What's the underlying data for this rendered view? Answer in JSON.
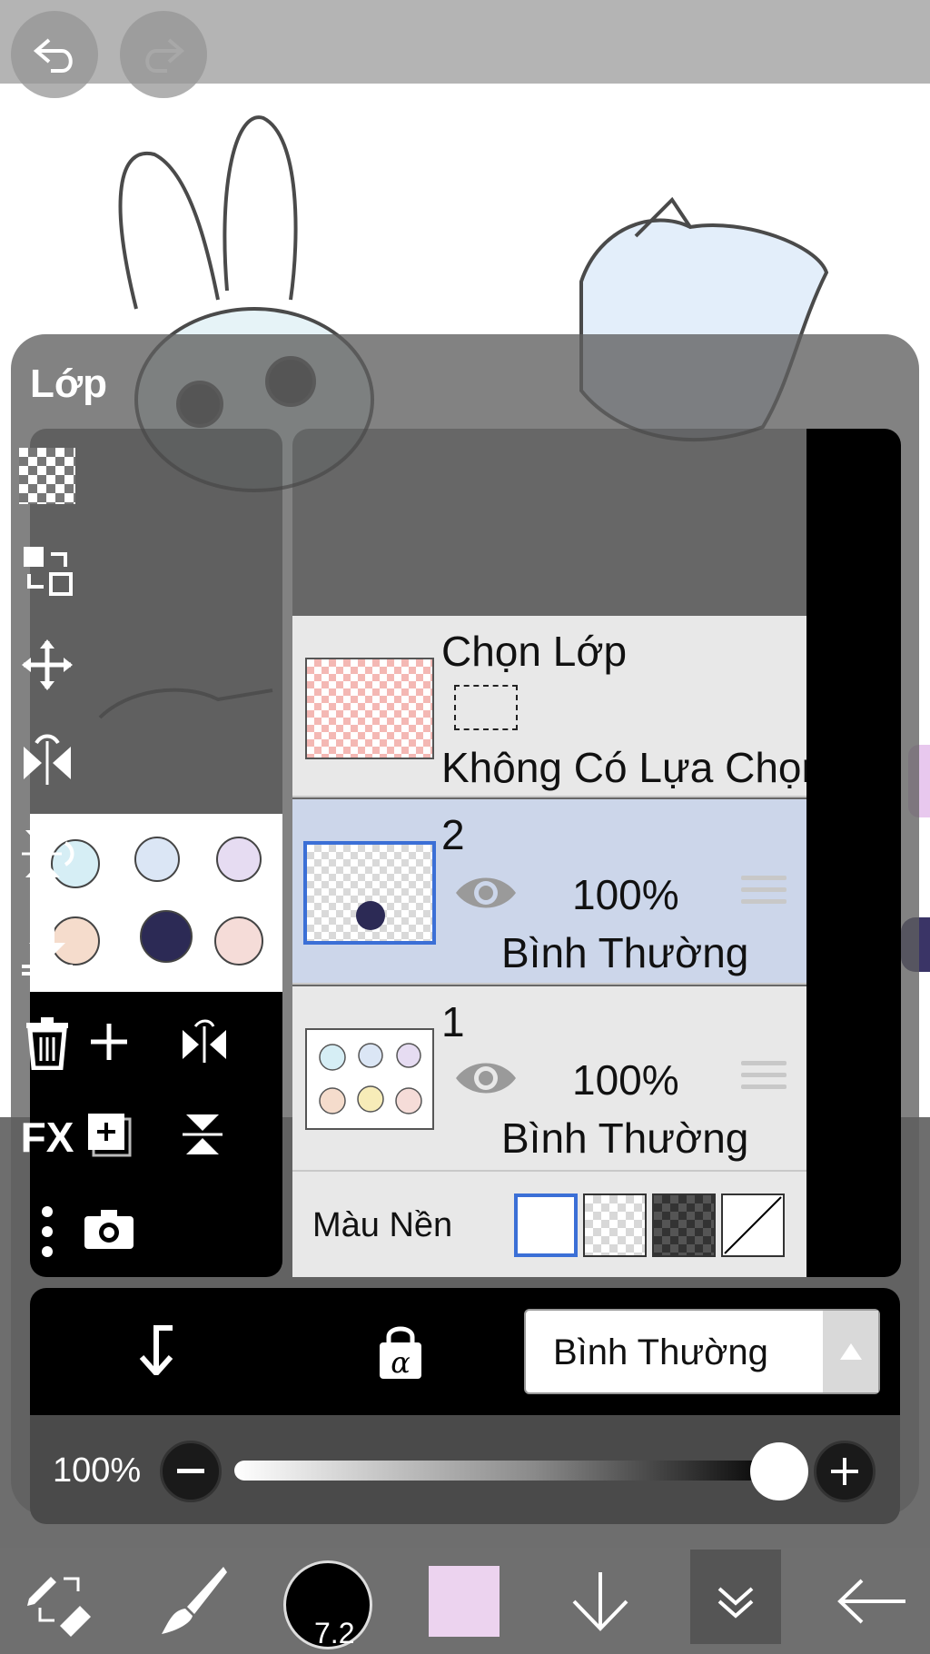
{
  "panel": {
    "title": "Lớp"
  },
  "selection_layer": {
    "title": "Chọn Lớp",
    "status": "Không Có Lựa Chọn"
  },
  "layers": [
    {
      "name": "2",
      "opacity": "100%",
      "blend": "Bình Thường",
      "selected": true
    },
    {
      "name": "1",
      "opacity": "100%",
      "blend": "Bình Thường",
      "selected": false
    }
  ],
  "background": {
    "label": "Màu Nền",
    "options": [
      "white",
      "transparent-light",
      "transparent-dark",
      "none"
    ],
    "selected": "white"
  },
  "right_tools": [
    "checker-icon",
    "copy-move-icon",
    "move-icon",
    "flip-horizontal-icon",
    "flip-vertical-icon",
    "merge-down-icon",
    "trash-icon",
    "fx-icon",
    "more-icon"
  ],
  "right_tools_fx_label": "FX",
  "bottom": {
    "blend_mode": "Bình Thường",
    "opacity_label": "100%",
    "opacity_value": 1.0
  },
  "toolbar": {
    "brush_size": "7.2",
    "color": "#ecd3ef"
  },
  "colors": {
    "accent": "#3b6fd6",
    "panel": "#5f5f5f",
    "active_row": "#ccd6ea"
  }
}
